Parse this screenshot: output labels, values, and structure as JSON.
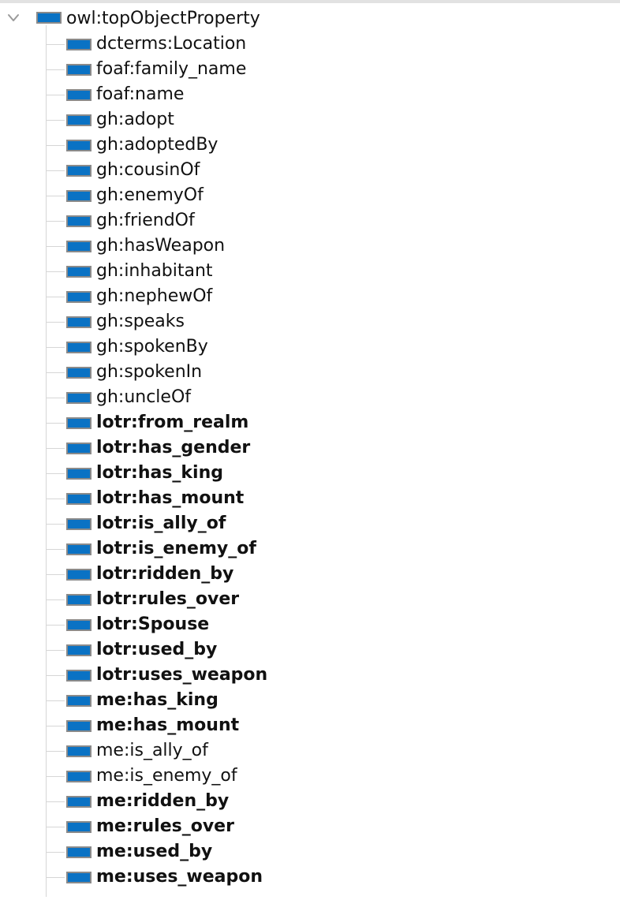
{
  "tree": {
    "root": {
      "label": "owl:topObjectProperty",
      "expanded": true,
      "icon": "object-property-icon"
    },
    "icon_color": "#0a72c4",
    "icon_border_color": "#8a8a8a",
    "children": [
      {
        "label": "dcterms:Location",
        "bold": false
      },
      {
        "label": "foaf:family_name",
        "bold": false
      },
      {
        "label": "foaf:name",
        "bold": false
      },
      {
        "label": "gh:adopt",
        "bold": false
      },
      {
        "label": "gh:adoptedBy",
        "bold": false
      },
      {
        "label": "gh:cousinOf",
        "bold": false
      },
      {
        "label": "gh:enemyOf",
        "bold": false
      },
      {
        "label": "gh:friendOf",
        "bold": false
      },
      {
        "label": "gh:hasWeapon",
        "bold": false
      },
      {
        "label": "gh:inhabitant",
        "bold": false
      },
      {
        "label": "gh:nephewOf",
        "bold": false
      },
      {
        "label": "gh:speaks",
        "bold": false
      },
      {
        "label": "gh:spokenBy",
        "bold": false
      },
      {
        "label": "gh:spokenIn",
        "bold": false
      },
      {
        "label": "gh:uncleOf",
        "bold": false
      },
      {
        "label": "lotr:from_realm",
        "bold": true
      },
      {
        "label": "lotr:has_gender",
        "bold": true
      },
      {
        "label": "lotr:has_king",
        "bold": true
      },
      {
        "label": "lotr:has_mount",
        "bold": true
      },
      {
        "label": "lotr:is_ally_of",
        "bold": true
      },
      {
        "label": "lotr:is_enemy_of",
        "bold": true
      },
      {
        "label": "lotr:ridden_by",
        "bold": true
      },
      {
        "label": "lotr:rules_over",
        "bold": true
      },
      {
        "label": "lotr:Spouse",
        "bold": true
      },
      {
        "label": "lotr:used_by",
        "bold": true
      },
      {
        "label": "lotr:uses_weapon",
        "bold": true
      },
      {
        "label": "me:has_king",
        "bold": true
      },
      {
        "label": "me:has_mount",
        "bold": true
      },
      {
        "label": "me:is_ally_of",
        "bold": false
      },
      {
        "label": "me:is_enemy_of",
        "bold": false
      },
      {
        "label": "me:ridden_by",
        "bold": true
      },
      {
        "label": "me:rules_over",
        "bold": true
      },
      {
        "label": "me:used_by",
        "bold": true
      },
      {
        "label": "me:uses_weapon",
        "bold": true
      }
    ]
  }
}
